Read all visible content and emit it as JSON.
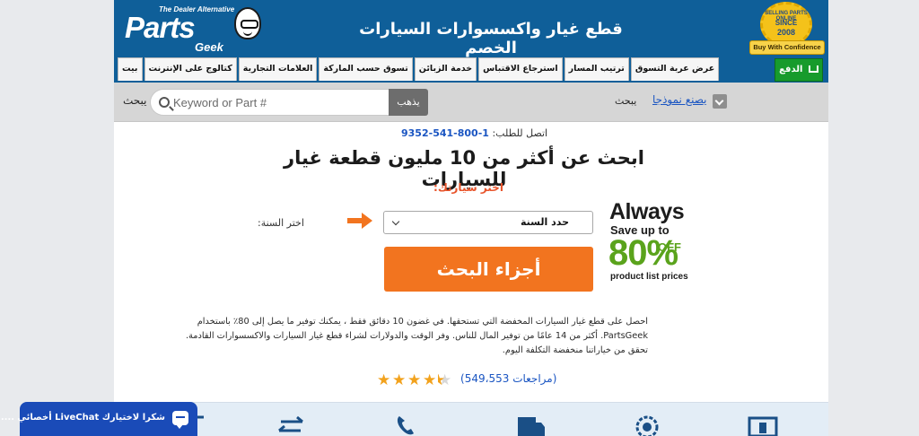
{
  "header": {
    "logo": {
      "tagline": "The Dealer Alternative",
      "name": "Parts",
      "sub": "Geek"
    },
    "title": "قطع غيار واكسسوارات السيارات الخصم",
    "badge": {
      "line1": "SELLING PARTS ONLINE",
      "line2": "SINCE",
      "line3": "2008",
      "ribbon": "Buy With Confidence"
    }
  },
  "nav": {
    "tabs": [
      "بيت",
      "كتالوج على الإنترنت",
      "العلامات التجارية",
      "تسوق حسب الماركة",
      "خدمة الزبائن",
      "استرجاع الاقتباس",
      "ترتيب المسار",
      "عرض عربة التسوق"
    ],
    "checkout_label": "الدفع"
  },
  "search": {
    "label_left": "يبحث",
    "placeholder": "Keyword or Part #",
    "go_label": "يذهب",
    "label_right": "يبحث",
    "model_link": "يصنع نموذجا"
  },
  "main": {
    "phone_label": "اتصل للطلب:",
    "phone_number": "1-800-541-9352",
    "headline": "ابحث عن أكثر من 10 مليون قطعة غيار للسيارات",
    "choose_car": "اختر سيارتك:",
    "year_label": "اختر السنة:",
    "year_select_value": "حدد السنة",
    "find_parts_button": "أجزاء البحث",
    "promo": {
      "always": "Always",
      "save_up_to": "Save up to",
      "percent": "80%",
      "off": "OFF",
      "product_list_prices": "product list prices"
    },
    "description": [
      "احصل على قطع غيار السيارات المخفضة التي تستحقها. في غضون 10 دقائق فقط ، يمكنك توفير ما يصل إلى 80٪ باستخدام",
      "PartsGeek. أكثر من 14 عامًا من توفير المال للناس. وفر الوقت والدولارات لشراء قطع غيار السيارات والاكسسوارات القادمة.",
      "تحقق من خياراتنا منخفضة التكلفة اليوم."
    ],
    "reviews_text": "(مراجعات 549،553)",
    "rating": 4.5
  },
  "livechat": {
    "label": "شكرا لاختيارك LiveChat أخصائي ...."
  },
  "colors": {
    "header_blue": "#0f5f99",
    "accent_orange": "#f2741f",
    "promo_green": "#5aa31c",
    "checkout_green": "#179b2c",
    "link_blue": "#1a55c2"
  }
}
